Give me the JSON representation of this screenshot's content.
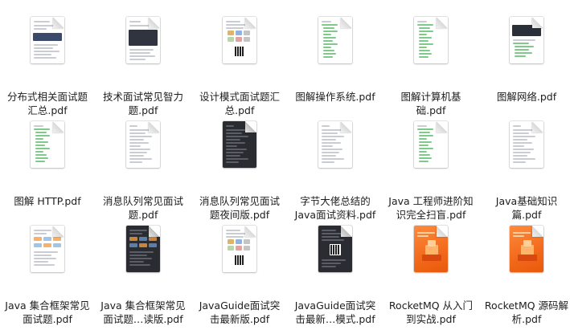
{
  "files": [
    {
      "line1": "分布式相关面试题",
      "line2": "汇总.pdf",
      "style": "light-banner"
    },
    {
      "line1": "技术面试常见智力",
      "line2": "题.pdf",
      "style": "light-code"
    },
    {
      "line1": "设计模式面试题汇",
      "line2": "总.pdf",
      "style": "light-qr"
    },
    {
      "line1": "图解操作系统.pdf",
      "line2": "",
      "style": "light-green"
    },
    {
      "line1": "图解计算机基",
      "line2": "础.pdf",
      "style": "light-green"
    },
    {
      "line1": "图解网络.pdf",
      "line2": "",
      "style": "light-dark-block"
    },
    {
      "line1": "图解 HTTP.pdf",
      "line2": "",
      "style": "light-green"
    },
    {
      "line1": "消息队列常见面试",
      "line2": "题.pdf",
      "style": "light-text"
    },
    {
      "line1": "消息队列常见面试",
      "line2": "题夜间版.pdf",
      "style": "dark-text"
    },
    {
      "line1": "字节大佬总结的",
      "line2": "Java面试资料.pdf",
      "style": "light-text"
    },
    {
      "line1": "Java 工程师进阶知",
      "line2": "识完全扫盲.pdf",
      "style": "light-green"
    },
    {
      "line1": "Java基础知识",
      "line2": "篇.pdf",
      "style": "light-text"
    },
    {
      "line1": "Java 集合框架常见",
      "line2": "面试题.pdf",
      "style": "light-diagram"
    },
    {
      "line1": "Java 集合框架常见",
      "line2": "面试题…读版.pdf",
      "style": "dark-diagram"
    },
    {
      "line1": "JavaGuide面试突",
      "line2": "击最新版.pdf",
      "style": "light-qr"
    },
    {
      "line1": "JavaGuide面试突",
      "line2": "击最新…模式.pdf",
      "style": "dark-qr"
    },
    {
      "line1": "RocketMQ 从入门",
      "line2": "到实战.pdf",
      "style": "orange"
    },
    {
      "line1": "RocketMQ 源码解",
      "line2": "析.pdf",
      "style": "orange"
    }
  ],
  "colors": {
    "text": "#1d1d1f",
    "background": "#ffffff",
    "accent_orange": "#f26a1b"
  },
  "icons": {
    "file": "pdf-file-icon"
  }
}
